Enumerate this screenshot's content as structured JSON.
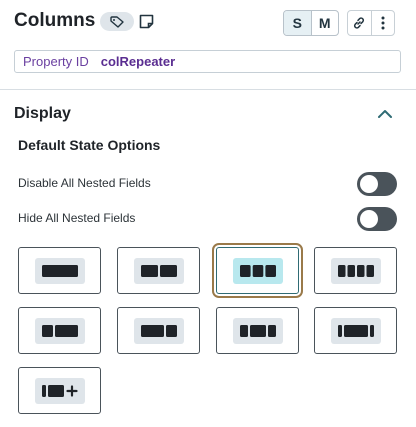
{
  "header": {
    "title": "Columns",
    "size_options": [
      "S",
      "M"
    ],
    "active_size": "S"
  },
  "property": {
    "label": "Property ID",
    "value": "colRepeater"
  },
  "display": {
    "title": "Display",
    "subtitle": "Default State Options",
    "toggles": [
      {
        "label": "Disable All Nested Fields",
        "on": false
      },
      {
        "label": "Hide All Nested Fields",
        "on": false
      }
    ]
  },
  "layouts": [
    {
      "icon": "single-column-layout-icon",
      "selected": false
    },
    {
      "icon": "two-equal-columns-layout-icon",
      "selected": false
    },
    {
      "icon": "three-equal-columns-layout-icon",
      "selected": true
    },
    {
      "icon": "four-equal-columns-layout-icon",
      "selected": false
    },
    {
      "icon": "one-third-two-thirds-layout-icon",
      "selected": false
    },
    {
      "icon": "two-thirds-one-third-layout-icon",
      "selected": false
    },
    {
      "icon": "quarter-half-quarter-layout-icon",
      "selected": false
    },
    {
      "icon": "narrow-wide-narrow-layout-icon",
      "selected": false
    },
    {
      "icon": "add-custom-layout-icon",
      "selected": false
    }
  ],
  "colors": {
    "accent_purple": "#5a2d91",
    "selected_fill": "#b8e8ee",
    "selected_outline": "#9a7a4a",
    "toggle_off": "#4a535a",
    "chevron": "#2f6b74"
  }
}
